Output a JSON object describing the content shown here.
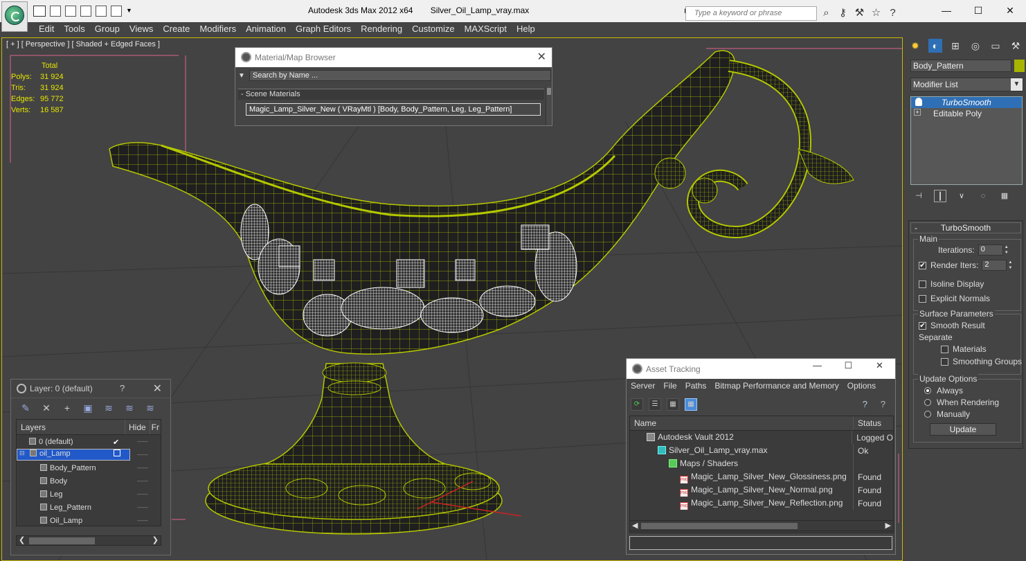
{
  "window": {
    "app_title": "Autodesk 3ds Max  2012 x64",
    "file_title": "Silver_Oil_Lamp_vray.max",
    "search_placeholder": "Type a keyword or phrase",
    "min": "—",
    "max": "☐",
    "close": "✕"
  },
  "menu": [
    "Edit",
    "Tools",
    "Group",
    "Views",
    "Create",
    "Modifiers",
    "Animation",
    "Graph Editors",
    "Rendering",
    "Customize",
    "MAXScript",
    "Help"
  ],
  "viewport": {
    "label": "[ + ] [ Perspective ] [ Shaded + Edged Faces ]",
    "stats_header": "Total",
    "stats": [
      {
        "label": "Polys:",
        "value": "31 924"
      },
      {
        "label": "Tris:",
        "value": "31 924"
      },
      {
        "label": "Edges:",
        "value": "95 772"
      },
      {
        "label": "Verts:",
        "value": "16 587"
      }
    ],
    "colors": {
      "wire": "#b5c800",
      "body": "#1f1f1f",
      "pattern": "#ffffff",
      "grid": "#3a3a3a"
    }
  },
  "material_browser": {
    "title": "Material/Map Browser",
    "search_placeholder": "Search by Name ...",
    "section": "- Scene Materials",
    "item": "Magic_Lamp_Silver_New  ( VRayMtl )  [Body, Body_Pattern, Leg, Leg_Pattern]",
    "close": "✕"
  },
  "layers": {
    "title": "Layer: 0 (default)",
    "help": "?",
    "close": "✕",
    "col_layers": "Layers",
    "col_hide": "Hide",
    "col_f": "Fr",
    "rows": [
      {
        "name": "0 (default)",
        "hide": "——"
      },
      {
        "name": "oil_Lamp",
        "hide": "——"
      },
      {
        "name": "Body_Pattern",
        "hide": "——"
      },
      {
        "name": "Body",
        "hide": "——"
      },
      {
        "name": "Leg",
        "hide": "——"
      },
      {
        "name": "Leg_Pattern",
        "hide": "——"
      },
      {
        "name": "Oil_Lamp",
        "hide": "——"
      }
    ]
  },
  "asset_tracking": {
    "title": "Asset Tracking",
    "menu": [
      "Server",
      "File",
      "Paths",
      "Bitmap Performance and Memory",
      "Options"
    ],
    "col_name": "Name",
    "col_status": "Status",
    "rows": [
      {
        "name": "Autodesk Vault 2012",
        "status": "Logged O",
        "icon": "vault-icon"
      },
      {
        "name": "Silver_Oil_Lamp_vray.max",
        "status": "Ok",
        "icon": "max-file-icon"
      },
      {
        "name": "Maps / Shaders",
        "status": "",
        "icon": "folder-icon"
      },
      {
        "name": "Magic_Lamp_Silver_New_Glossiness.png",
        "status": "Found",
        "icon": "png-icon"
      },
      {
        "name": "Magic_Lamp_Silver_New_Normal.png",
        "status": "Found",
        "icon": "png-icon"
      },
      {
        "name": "Magic_Lamp_Silver_New_Reflection.png",
        "status": "Found",
        "icon": "png-icon"
      }
    ]
  },
  "command_panel": {
    "object_name": "Body_Pattern",
    "modifier_list": "Modifier List",
    "stack": [
      "TurboSmooth",
      "Editable Poly"
    ],
    "rollout_title": "TurboSmooth",
    "main_label": "Main",
    "iterations_label": "Iterations:",
    "iterations": "0",
    "render_iters_label": "Render Iters:",
    "render_iters": "2",
    "isoline": "Isoline Display",
    "explicit": "Explicit Normals",
    "surface_label": "Surface Parameters",
    "smooth_result": "Smooth Result",
    "separate": "Separate",
    "materials": "Materials",
    "smoothing_groups": "Smoothing Groups",
    "update_label": "Update Options",
    "always": "Always",
    "when_rendering": "When Rendering",
    "manually": "Manually",
    "update_btn": "Update"
  }
}
